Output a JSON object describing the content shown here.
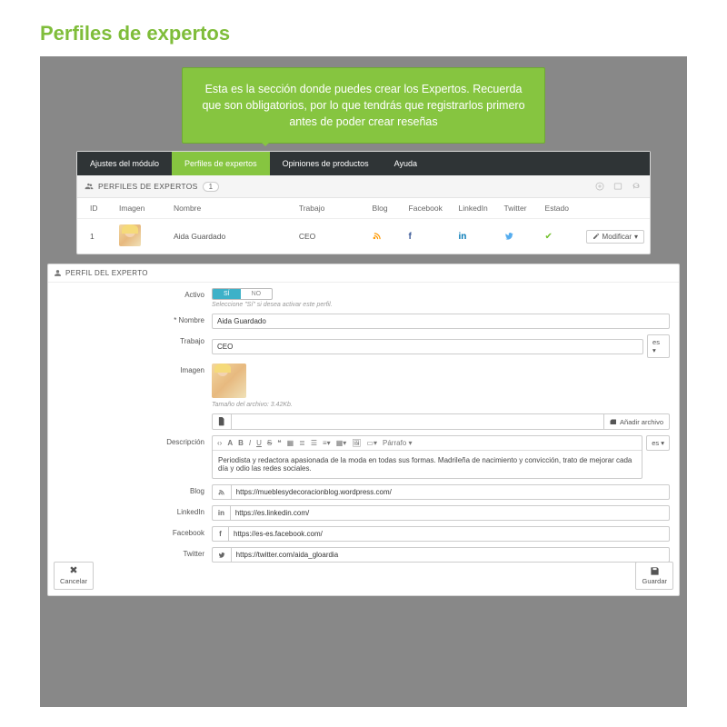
{
  "page_title": "Perfiles de expertos",
  "tooltip": "Esta es la sección donde puedes crear los Expertos. Recuerda que son obligatorios, por lo que tendrás que registrarlos primero antes de poder crear reseñas",
  "tabs": [
    "Ajustes del módulo",
    "Perfiles de expertos",
    "Opiniones de productos",
    "Ayuda"
  ],
  "list": {
    "title": "PERFILES DE EXPERTOS",
    "count": "1",
    "columns": [
      "ID",
      "Imagen",
      "Nombre",
      "Trabajo",
      "Blog",
      "Facebook",
      "LinkedIn",
      "Twitter",
      "Estado",
      ""
    ],
    "row": {
      "id": "1",
      "nombre": "Aida Guardado",
      "trabajo": "CEO",
      "modify": "Modificar"
    }
  },
  "form": {
    "title": "PERFIL DEL EXPERTO",
    "labels": {
      "activo": "Activo",
      "nombre": "* Nombre",
      "trabajo": "Trabajo",
      "imagen": "Imagen",
      "descripcion": "Descripción",
      "blog": "Blog",
      "linkedin": "LinkedIn",
      "facebook": "Facebook",
      "twitter": "Twitter"
    },
    "toggle": {
      "on": "SÍ",
      "off": "NO"
    },
    "hint_activo": "Seleccione \"Sí\" si desea activar este perfil.",
    "nombre": "Aida Guardado",
    "trabajo": "CEO",
    "lang": "es ▾",
    "img_hint": "Tamaño del archivo: 3.42Kb.",
    "file_btn": "Añadir archivo",
    "rte_font": "Párrafo ▾",
    "descripcion": "Periodista y redactora apasionada de la moda en todas sus formas. Madrileña de nacimiento y convicción, trato de mejorar cada día y odio las redes sociales.",
    "blog": "https://mueblesydecoracionblog.wordpress.com/",
    "linkedin": "https://es.linkedin.com/",
    "facebook": "https://es-es.facebook.com/",
    "twitter": "https://twitter.com/aida_gloardia",
    "cancel": "Cancelar",
    "save": "Guardar"
  }
}
